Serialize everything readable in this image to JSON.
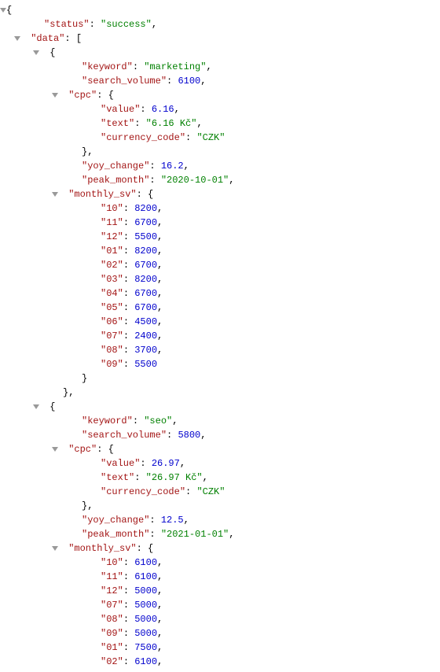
{
  "rows": [
    {
      "depth": 0,
      "caret": true,
      "segs": [
        {
          "t": "{",
          "c": "punct"
        }
      ]
    },
    {
      "depth": 2,
      "segs": [
        {
          "t": "\"status\"",
          "c": "key"
        },
        {
          "t": ": ",
          "c": "punct"
        },
        {
          "t": "\"success\"",
          "c": "str"
        },
        {
          "t": ",",
          "c": "punct"
        }
      ]
    },
    {
      "depth": 1,
      "caret": true,
      "segs": [
        {
          "t": " ",
          "c": "punct"
        },
        {
          "t": "\"data\"",
          "c": "key"
        },
        {
          "t": ": [",
          "c": "punct"
        }
      ]
    },
    {
      "depth": 2,
      "caret": true,
      "segs": [
        {
          "t": " {",
          "c": "punct"
        }
      ]
    },
    {
      "depth": 4,
      "segs": [
        {
          "t": "\"keyword\"",
          "c": "key"
        },
        {
          "t": ": ",
          "c": "punct"
        },
        {
          "t": "\"marketing\"",
          "c": "str"
        },
        {
          "t": ",",
          "c": "punct"
        }
      ]
    },
    {
      "depth": 4,
      "segs": [
        {
          "t": "\"search_volume\"",
          "c": "key"
        },
        {
          "t": ": ",
          "c": "punct"
        },
        {
          "t": "6100",
          "c": "num"
        },
        {
          "t": ",",
          "c": "punct"
        }
      ]
    },
    {
      "depth": 3,
      "caret": true,
      "segs": [
        {
          "t": " ",
          "c": "punct"
        },
        {
          "t": "\"cpc\"",
          "c": "key"
        },
        {
          "t": ": {",
          "c": "punct"
        }
      ]
    },
    {
      "depth": 5,
      "segs": [
        {
          "t": "\"value\"",
          "c": "key"
        },
        {
          "t": ": ",
          "c": "punct"
        },
        {
          "t": "6.16",
          "c": "num"
        },
        {
          "t": ",",
          "c": "punct"
        }
      ]
    },
    {
      "depth": 5,
      "segs": [
        {
          "t": "\"text\"",
          "c": "key"
        },
        {
          "t": ": ",
          "c": "punct"
        },
        {
          "t": "\"6.16 Kč\"",
          "c": "str"
        },
        {
          "t": ",",
          "c": "punct"
        }
      ]
    },
    {
      "depth": 5,
      "segs": [
        {
          "t": "\"currency_code\"",
          "c": "key"
        },
        {
          "t": ": ",
          "c": "punct"
        },
        {
          "t": "\"CZK\"",
          "c": "str"
        }
      ]
    },
    {
      "depth": 4,
      "segs": [
        {
          "t": "},",
          "c": "punct"
        }
      ]
    },
    {
      "depth": 4,
      "segs": [
        {
          "t": "\"yoy_change\"",
          "c": "key"
        },
        {
          "t": ": ",
          "c": "punct"
        },
        {
          "t": "16.2",
          "c": "num"
        },
        {
          "t": ",",
          "c": "punct"
        }
      ]
    },
    {
      "depth": 4,
      "segs": [
        {
          "t": "\"peak_month\"",
          "c": "key"
        },
        {
          "t": ": ",
          "c": "punct"
        },
        {
          "t": "\"2020-10-01\"",
          "c": "str"
        },
        {
          "t": ",",
          "c": "punct"
        }
      ]
    },
    {
      "depth": 3,
      "caret": true,
      "segs": [
        {
          "t": " ",
          "c": "punct"
        },
        {
          "t": "\"monthly_sv\"",
          "c": "key"
        },
        {
          "t": ": {",
          "c": "punct"
        }
      ]
    },
    {
      "depth": 5,
      "segs": [
        {
          "t": "\"10\"",
          "c": "key"
        },
        {
          "t": ": ",
          "c": "punct"
        },
        {
          "t": "8200",
          "c": "num"
        },
        {
          "t": ",",
          "c": "punct"
        }
      ]
    },
    {
      "depth": 5,
      "segs": [
        {
          "t": "\"11\"",
          "c": "key"
        },
        {
          "t": ": ",
          "c": "punct"
        },
        {
          "t": "6700",
          "c": "num"
        },
        {
          "t": ",",
          "c": "punct"
        }
      ]
    },
    {
      "depth": 5,
      "segs": [
        {
          "t": "\"12\"",
          "c": "key"
        },
        {
          "t": ": ",
          "c": "punct"
        },
        {
          "t": "5500",
          "c": "num"
        },
        {
          "t": ",",
          "c": "punct"
        }
      ]
    },
    {
      "depth": 5,
      "segs": [
        {
          "t": "\"01\"",
          "c": "key"
        },
        {
          "t": ": ",
          "c": "punct"
        },
        {
          "t": "8200",
          "c": "num"
        },
        {
          "t": ",",
          "c": "punct"
        }
      ]
    },
    {
      "depth": 5,
      "segs": [
        {
          "t": "\"02\"",
          "c": "key"
        },
        {
          "t": ": ",
          "c": "punct"
        },
        {
          "t": "6700",
          "c": "num"
        },
        {
          "t": ",",
          "c": "punct"
        }
      ]
    },
    {
      "depth": 5,
      "segs": [
        {
          "t": "\"03\"",
          "c": "key"
        },
        {
          "t": ": ",
          "c": "punct"
        },
        {
          "t": "8200",
          "c": "num"
        },
        {
          "t": ",",
          "c": "punct"
        }
      ]
    },
    {
      "depth": 5,
      "segs": [
        {
          "t": "\"04\"",
          "c": "key"
        },
        {
          "t": ": ",
          "c": "punct"
        },
        {
          "t": "6700",
          "c": "num"
        },
        {
          "t": ",",
          "c": "punct"
        }
      ]
    },
    {
      "depth": 5,
      "segs": [
        {
          "t": "\"05\"",
          "c": "key"
        },
        {
          "t": ": ",
          "c": "punct"
        },
        {
          "t": "6700",
          "c": "num"
        },
        {
          "t": ",",
          "c": "punct"
        }
      ]
    },
    {
      "depth": 5,
      "segs": [
        {
          "t": "\"06\"",
          "c": "key"
        },
        {
          "t": ": ",
          "c": "punct"
        },
        {
          "t": "4500",
          "c": "num"
        },
        {
          "t": ",",
          "c": "punct"
        }
      ]
    },
    {
      "depth": 5,
      "segs": [
        {
          "t": "\"07\"",
          "c": "key"
        },
        {
          "t": ": ",
          "c": "punct"
        },
        {
          "t": "2400",
          "c": "num"
        },
        {
          "t": ",",
          "c": "punct"
        }
      ]
    },
    {
      "depth": 5,
      "segs": [
        {
          "t": "\"08\"",
          "c": "key"
        },
        {
          "t": ": ",
          "c": "punct"
        },
        {
          "t": "3700",
          "c": "num"
        },
        {
          "t": ",",
          "c": "punct"
        }
      ]
    },
    {
      "depth": 5,
      "segs": [
        {
          "t": "\"09\"",
          "c": "key"
        },
        {
          "t": ": ",
          "c": "punct"
        },
        {
          "t": "5500",
          "c": "num"
        }
      ]
    },
    {
      "depth": 4,
      "segs": [
        {
          "t": "}",
          "c": "punct"
        }
      ]
    },
    {
      "depth": 3,
      "segs": [
        {
          "t": "},",
          "c": "punct"
        }
      ]
    },
    {
      "depth": 2,
      "caret": true,
      "segs": [
        {
          "t": " {",
          "c": "punct"
        }
      ]
    },
    {
      "depth": 4,
      "segs": [
        {
          "t": "\"keyword\"",
          "c": "key"
        },
        {
          "t": ": ",
          "c": "punct"
        },
        {
          "t": "\"seo\"",
          "c": "str"
        },
        {
          "t": ",",
          "c": "punct"
        }
      ]
    },
    {
      "depth": 4,
      "segs": [
        {
          "t": "\"search_volume\"",
          "c": "key"
        },
        {
          "t": ": ",
          "c": "punct"
        },
        {
          "t": "5800",
          "c": "num"
        },
        {
          "t": ",",
          "c": "punct"
        }
      ]
    },
    {
      "depth": 3,
      "caret": true,
      "segs": [
        {
          "t": " ",
          "c": "punct"
        },
        {
          "t": "\"cpc\"",
          "c": "key"
        },
        {
          "t": ": {",
          "c": "punct"
        }
      ]
    },
    {
      "depth": 5,
      "segs": [
        {
          "t": "\"value\"",
          "c": "key"
        },
        {
          "t": ": ",
          "c": "punct"
        },
        {
          "t": "26.97",
          "c": "num"
        },
        {
          "t": ",",
          "c": "punct"
        }
      ]
    },
    {
      "depth": 5,
      "segs": [
        {
          "t": "\"text\"",
          "c": "key"
        },
        {
          "t": ": ",
          "c": "punct"
        },
        {
          "t": "\"26.97 Kč\"",
          "c": "str"
        },
        {
          "t": ",",
          "c": "punct"
        }
      ]
    },
    {
      "depth": 5,
      "segs": [
        {
          "t": "\"currency_code\"",
          "c": "key"
        },
        {
          "t": ": ",
          "c": "punct"
        },
        {
          "t": "\"CZK\"",
          "c": "str"
        }
      ]
    },
    {
      "depth": 4,
      "segs": [
        {
          "t": "},",
          "c": "punct"
        }
      ]
    },
    {
      "depth": 4,
      "segs": [
        {
          "t": "\"yoy_change\"",
          "c": "key"
        },
        {
          "t": ": ",
          "c": "punct"
        },
        {
          "t": "12.5",
          "c": "num"
        },
        {
          "t": ",",
          "c": "punct"
        }
      ]
    },
    {
      "depth": 4,
      "segs": [
        {
          "t": "\"peak_month\"",
          "c": "key"
        },
        {
          "t": ": ",
          "c": "punct"
        },
        {
          "t": "\"2021-01-01\"",
          "c": "str"
        },
        {
          "t": ",",
          "c": "punct"
        }
      ]
    },
    {
      "depth": 3,
      "caret": true,
      "segs": [
        {
          "t": " ",
          "c": "punct"
        },
        {
          "t": "\"monthly_sv\"",
          "c": "key"
        },
        {
          "t": ": {",
          "c": "punct"
        }
      ]
    },
    {
      "depth": 5,
      "segs": [
        {
          "t": "\"10\"",
          "c": "key"
        },
        {
          "t": ": ",
          "c": "punct"
        },
        {
          "t": "6100",
          "c": "num"
        },
        {
          "t": ",",
          "c": "punct"
        }
      ]
    },
    {
      "depth": 5,
      "segs": [
        {
          "t": "\"11\"",
          "c": "key"
        },
        {
          "t": ": ",
          "c": "punct"
        },
        {
          "t": "6100",
          "c": "num"
        },
        {
          "t": ",",
          "c": "punct"
        }
      ]
    },
    {
      "depth": 5,
      "segs": [
        {
          "t": "\"12\"",
          "c": "key"
        },
        {
          "t": ": ",
          "c": "punct"
        },
        {
          "t": "5000",
          "c": "num"
        },
        {
          "t": ",",
          "c": "punct"
        }
      ]
    },
    {
      "depth": 5,
      "segs": [
        {
          "t": "\"07\"",
          "c": "key"
        },
        {
          "t": ": ",
          "c": "punct"
        },
        {
          "t": "5000",
          "c": "num"
        },
        {
          "t": ",",
          "c": "punct"
        }
      ]
    },
    {
      "depth": 5,
      "segs": [
        {
          "t": "\"08\"",
          "c": "key"
        },
        {
          "t": ": ",
          "c": "punct"
        },
        {
          "t": "5000",
          "c": "num"
        },
        {
          "t": ",",
          "c": "punct"
        }
      ]
    },
    {
      "depth": 5,
      "segs": [
        {
          "t": "\"09\"",
          "c": "key"
        },
        {
          "t": ": ",
          "c": "punct"
        },
        {
          "t": "5000",
          "c": "num"
        },
        {
          "t": ",",
          "c": "punct"
        }
      ]
    },
    {
      "depth": 5,
      "segs": [
        {
          "t": "\"01\"",
          "c": "key"
        },
        {
          "t": ": ",
          "c": "punct"
        },
        {
          "t": "7500",
          "c": "num"
        },
        {
          "t": ",",
          "c": "punct"
        }
      ]
    },
    {
      "depth": 5,
      "segs": [
        {
          "t": "\"02\"",
          "c": "key"
        },
        {
          "t": ": ",
          "c": "punct"
        },
        {
          "t": "6100",
          "c": "num"
        },
        {
          "t": ",",
          "c": "punct"
        }
      ]
    }
  ]
}
